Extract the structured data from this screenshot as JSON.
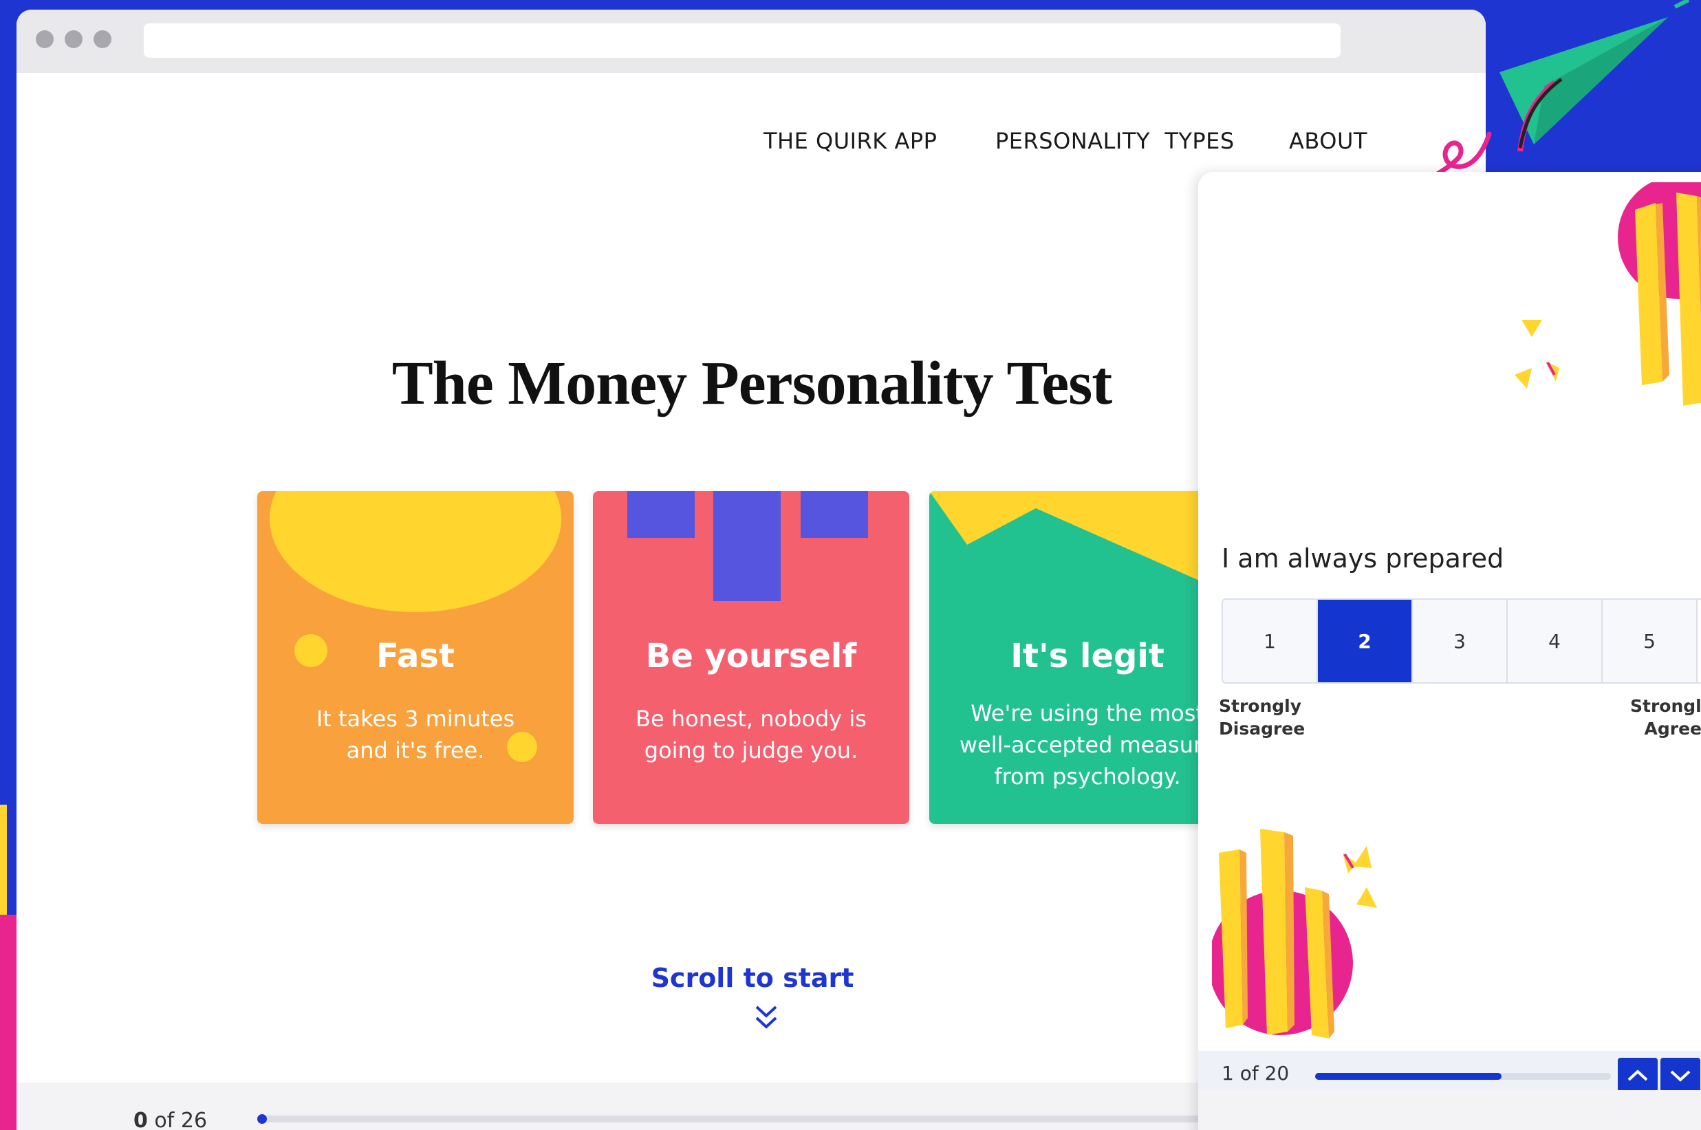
{
  "browser": {
    "nav": {
      "app": "THE QUIRK APP",
      "types": "PERSONALITY  TYPES",
      "about": "ABOUT"
    }
  },
  "main": {
    "title": "The Money Personality Test",
    "cards": [
      {
        "title": "Fast",
        "line1": "It takes 3 minutes",
        "line2": "and it's free.",
        "color": "#f9a13d"
      },
      {
        "title": "Be yourself",
        "line1": "Be honest, nobody is",
        "line2": "going to judge you.",
        "color": "#f5606f"
      },
      {
        "title": "It's legit",
        "line1": "We're using the most",
        "line2": "well-accepted measure",
        "line3": "from psychology.",
        "color": "#22c190"
      }
    ],
    "scroll_label": "Scroll to start"
  },
  "footer": {
    "current": "0",
    "total_text": " of 26"
  },
  "quiz": {
    "question": "I am always prepared",
    "options": [
      "1",
      "2",
      "3",
      "4",
      "5"
    ],
    "selected": "2",
    "label_left_1": "Strongly",
    "label_left_2": "Disagree",
    "label_right_1": "Strongly",
    "label_right_2": "Agree",
    "progress_text": "1 of 20",
    "progress_fraction": 0.63
  },
  "colors": {
    "brand_blue": "#1f35d1",
    "yellow": "#ffd52e",
    "pink": "#e8258f",
    "teal": "#22c190"
  }
}
